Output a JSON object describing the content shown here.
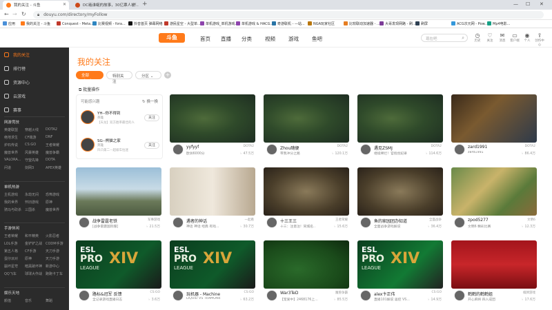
{
  "browser": {
    "tabs": [
      {
        "label": "我的关注 - 斗鱼",
        "active": true
      },
      {
        "label": "DC戢谁蜒的故事，30亿票人被..."
      }
    ],
    "url": "douyu.com/directory/myFollow",
    "bookmarks": [
      {
        "label": "应用",
        "color": "#4a90d9"
      },
      {
        "label": "我的关注 - 斗鱼",
        "color": "#ff7a1a"
      },
      {
        "label": "Conquest - Meta...",
        "color": "#c0392b"
      },
      {
        "label": "比赛视频 - fora...",
        "color": "#2e86c1"
      },
      {
        "label": "抖音首页 弹幕网络",
        "color": "#111111"
      },
      {
        "label": "游民星空 - 大型单...",
        "color": "#c0392b"
      },
      {
        "label": "单机游戏_单机游戏...",
        "color": "#8e44ad"
      },
      {
        "label": "单机游戏 & HACG...",
        "color": "#8e44ad"
      },
      {
        "label": "奇游联机 - —站...",
        "color": "#2874a6"
      },
      {
        "label": "NGA玩家社区",
        "color": "#b9770e"
      },
      {
        "label": "比较联动加速器 - ...",
        "color": "#e67e22"
      },
      {
        "label": "大哥发现网路 - 刷...",
        "color": "#7d3c98"
      },
      {
        "label": "刷屏",
        "color": "#2e4053"
      },
      {
        "label": "ACG次元网 - Pow...",
        "color": "#3498db"
      },
      {
        "label": "Mp4电影...",
        "color": "#16a085"
      }
    ]
  },
  "header": {
    "logo": "斗鱼",
    "nav": [
      "首页",
      "直播",
      "分类",
      "视频",
      "游戏",
      "鱼吧"
    ],
    "search_placeholder": "现在吧",
    "icons": [
      {
        "name": "history-icon",
        "glyph": "◷",
        "label": "历史"
      },
      {
        "name": "follow-icon",
        "glyph": "♡",
        "label": "关注"
      },
      {
        "name": "message-icon",
        "glyph": "✉",
        "label": "消息"
      },
      {
        "name": "client-icon",
        "glyph": "▭",
        "label": "客户端"
      },
      {
        "name": "user-avatar-icon",
        "glyph": "◉",
        "label": "个人"
      },
      {
        "name": "upload-icon",
        "glyph": "⇪",
        "label": "创作中心"
      }
    ]
  },
  "sidebar": {
    "items": [
      {
        "label": "我的关注",
        "active": true
      },
      {
        "label": "排行榜"
      },
      {
        "label": "资源中心"
      },
      {
        "label": "云游戏"
      },
      {
        "label": "赛事"
      }
    ],
    "sections": [
      {
        "title": "网游竞技",
        "games": [
          "英雄联盟",
          "穿越火线",
          "DOTA2",
          "绝地求生",
          "CF端游",
          "DNF",
          "炉石传说",
          "CS:GO",
          "王者荣耀",
          "魔兽世界",
          "风暴英雄",
          "魔兽争霸",
          "VALORA...",
          "守望先锋",
          "DOTA",
          "问道",
          "剑网3",
          "APEX英雄"
        ]
      },
      {
        "title": "单机热游",
        "games": [
          "主机游戏",
          "永劫无间",
          "恐怖游戏",
          "我的世界",
          "怀旧游戏",
          "原神",
          "骑马与砍杀",
          "三国杀",
          "魔兽世界"
        ]
      },
      {
        "title": "手游休闲",
        "games": [
          "王者荣耀",
          "和平精英",
          "火影忍者",
          "LOL手游",
          "金铲铲之战",
          "CODM手游",
          "第五人格",
          "CF手游",
          "天刀手游",
          "蛋仔派对",
          "原神",
          "天刀手游",
          "崩坏星穹",
          "暗黑破坏神",
          "新游中心",
          "QQ飞车",
          "球球大作战",
          "跑跑卡丁车"
        ]
      },
      {
        "title": "娱乐天地",
        "games": [
          "颜值",
          "音乐",
          "舞蹈"
        ]
      }
    ]
  },
  "main": {
    "title": "我的关注",
    "filters": [
      {
        "label": "全部（15）",
        "active": true
      },
      {
        "label": "特别关注"
      },
      {
        "label": "分区"
      }
    ],
    "batch_label": "批量操作",
    "recommend": {
      "title": "可能感兴趣",
      "refresh": "换一换",
      "items": [
        {
          "name": "YH--你不得到",
          "sub": "英雄",
          "desc": "【天龙】双方胜率最佳的人",
          "btn": "关注"
        },
        {
          "name": "SG--熊猫之家",
          "sub": "英雄",
          "desc": "凹凸第二—超级车拉迷",
          "btn": "关注"
        }
      ]
    },
    "cards": [
      {
        "name": "yyfyyf",
        "category": "DOTA2",
        "title": "欧洲6000分",
        "hot": "47.5万",
        "thumb": "dota"
      },
      {
        "name": "Zhou随便",
        "category": "DOTA2",
        "title": "带我冲分之路",
        "hot": "120.1万",
        "thumb": "dota"
      },
      {
        "name": "遇见ZSMJ",
        "category": "DOTA2",
        "title": "继续稀烂！官指创纪录",
        "hot": "114.6万",
        "thumb": "dota"
      },
      {
        "name": "zard1991",
        "category": "DOTA2",
        "title": "zard1991",
        "hot": "86.4万",
        "thumb": "card"
      },
      {
        "name": "战争雷霆老铁",
        "category": "军事游戏",
        "title": "[战争雷霆国际服]",
        "hot": "21.5万",
        "thumb": "sky"
      },
      {
        "name": "遇者的神话",
        "category": "一起看",
        "title": "神话 神话 经典 有戏...",
        "hot": "30.7万",
        "thumb": "movie"
      },
      {
        "name": "十三王三",
        "category": "王者荣耀",
        "title": "十三：注意注！同城名..",
        "hot": "15.6万",
        "thumb": "rts"
      },
      {
        "name": "鱼的家园团办知道",
        "category": "全面战争",
        "title": "全面战争游戏解说",
        "hot": "36.4万",
        "thumb": "rts"
      },
      {
        "name": "zpod5277",
        "category": "文明6",
        "title": "文明6 精彩比赛",
        "hot": "12.3万",
        "thumb": "map"
      },
      {
        "name": "路标&冠军 反馈",
        "category": "CS:GO",
        "title": "全记录游戏直播日志",
        "hot": "3.6万",
        "thumb": "esl"
      },
      {
        "name": "玩机器 - Machine",
        "category": "CS:GO",
        "title": "LIQUID VS TEAMONE",
        "hot": "63.2万",
        "thumb": "esl"
      },
      {
        "name": "War3TeD",
        "category": "魔兽争霸",
        "title": "【宠爱中】2468176上...",
        "hot": "85.5万",
        "thumb": "war3"
      },
      {
        "name": "alex卞正伟",
        "category": "CS:GO",
        "title": "直播101解说 遥控 VS...",
        "hot": "14.9万",
        "thumb": "esl2"
      },
      {
        "name": "鹤鹤的鹤鹤姐",
        "category": "棋牌游戏",
        "title": "开心麻将 四人成团",
        "hot": "17.6万",
        "thumb": "mahjong"
      }
    ]
  }
}
